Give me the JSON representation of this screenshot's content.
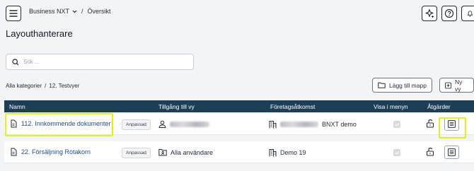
{
  "breadcrumb": {
    "root": "Business NXT",
    "separator": "/",
    "current": "Översikt"
  },
  "page": {
    "title": "Layouthanterare"
  },
  "search": {
    "placeholder": "Sök ..."
  },
  "filter": {
    "category": "Alla kategorier",
    "separator": "/",
    "subcategory": "12. Testvyer"
  },
  "buttons": {
    "add_folder": "Lägg till mapp",
    "new_view": "Ny vy"
  },
  "table": {
    "headers": {
      "name": "Namn",
      "access": "Tillgång till vy",
      "company": "Företagsåtkomst",
      "show_in_menu": "Visa i menyn",
      "actions": "Åtgärder"
    },
    "rows": [
      {
        "name": "112. Innkommende dokumenter",
        "tag": "Anpassad",
        "access": "",
        "company_suffix": "BNXT demo",
        "highlighted": true
      },
      {
        "name": "22. Försäljning Rotakorn",
        "tag": "Anpassad",
        "access": "Alla användare",
        "company": "Demo 19",
        "highlighted": false
      }
    ]
  },
  "colors": {
    "header_bg": "#1c3f57",
    "highlight": "#e3f01e",
    "link": "#1f4e8c",
    "page_bg": "#f3f4f6"
  }
}
